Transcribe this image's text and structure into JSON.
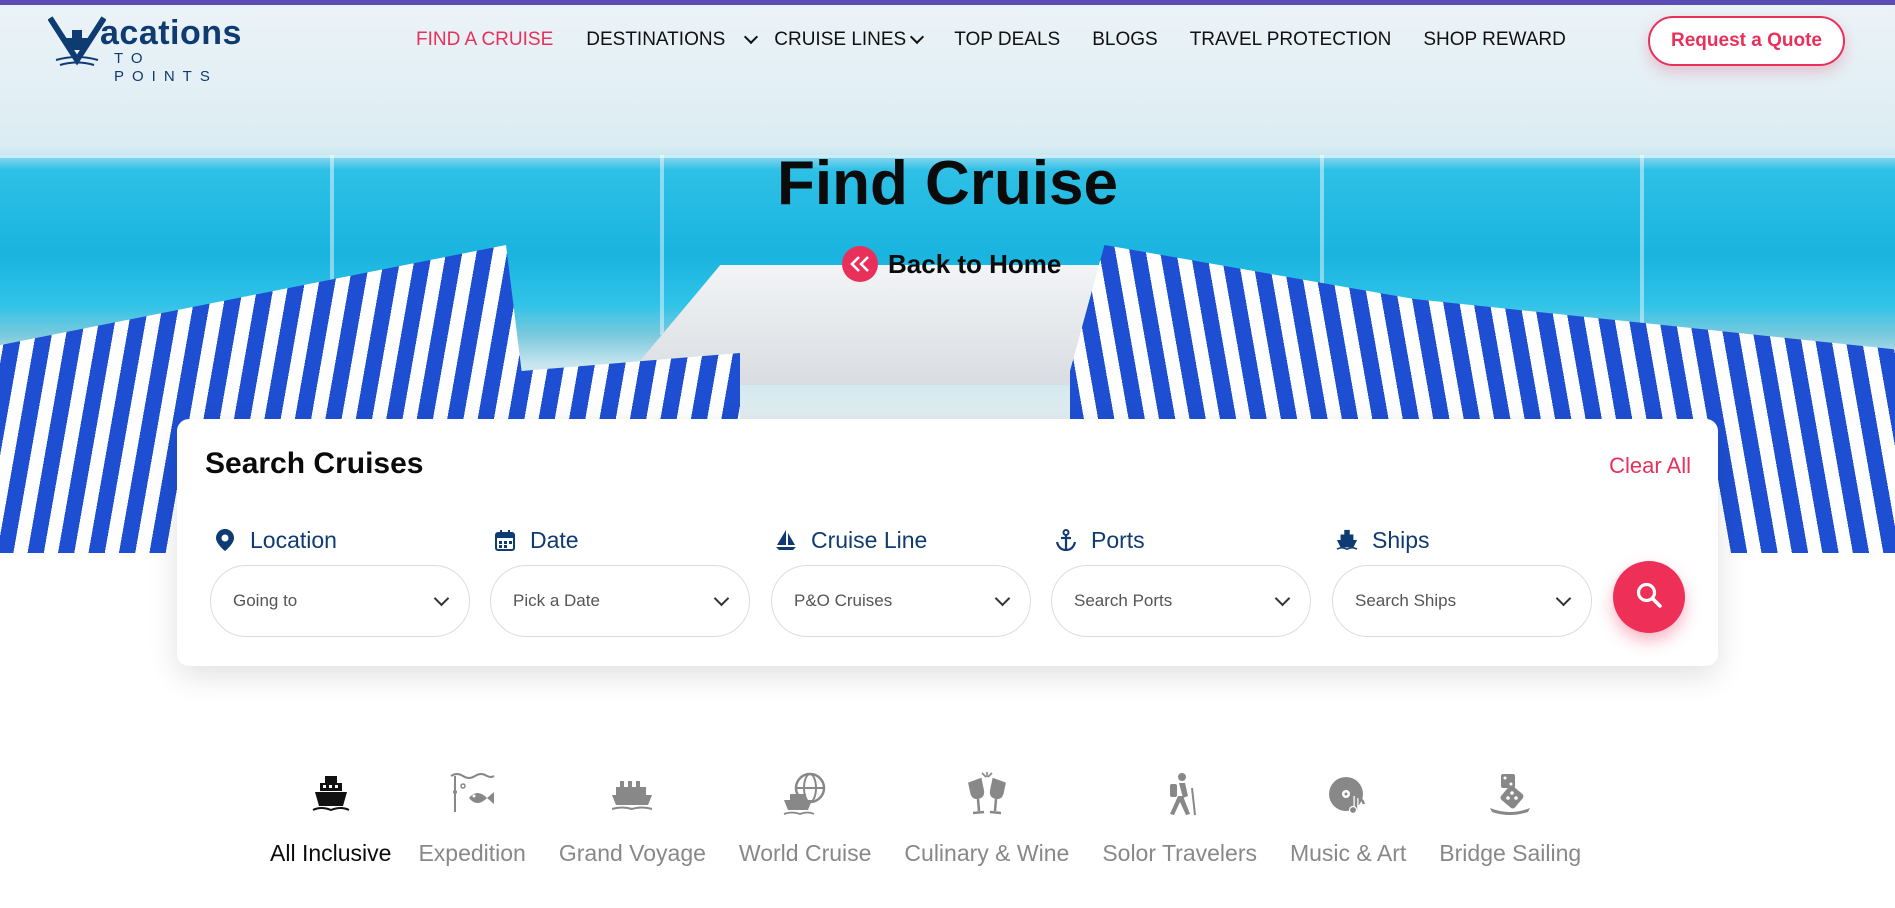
{
  "header": {
    "logo": {
      "main": "acations",
      "sub": "TO POINTS"
    },
    "nav": [
      {
        "label": "FIND A CRUISE",
        "active": true,
        "dropdown": false
      },
      {
        "label": "DESTINATIONS",
        "active": false,
        "dropdown": true
      },
      {
        "label": "CRUISE LINES",
        "active": false,
        "dropdown": true
      },
      {
        "label": "TOP DEALS",
        "active": false,
        "dropdown": false
      },
      {
        "label": "BLOGS",
        "active": false,
        "dropdown": false
      },
      {
        "label": "TRAVEL PROTECTION",
        "active": false,
        "dropdown": false
      },
      {
        "label": "SHOP REWARD",
        "active": false,
        "dropdown": false
      }
    ],
    "quote_button": "Request a Quote"
  },
  "hero": {
    "title": "Find Cruise",
    "back_link": "Back to Home",
    "back_icon": "double-chevron-left-icon"
  },
  "search": {
    "title": "Search Cruises",
    "clear_all": "Clear All",
    "fields": [
      {
        "label": "Location",
        "icon": "location-pin-icon",
        "value": "Going to"
      },
      {
        "label": "Date",
        "icon": "calendar-icon",
        "value": "Pick a Date"
      },
      {
        "label": "Cruise Line",
        "icon": "sailboat-icon",
        "value": "P&O Cruises"
      },
      {
        "label": "Ports",
        "icon": "anchor-icon",
        "value": "Search Ports"
      },
      {
        "label": "Ships",
        "icon": "ship-icon",
        "value": "Search Ships"
      }
    ],
    "search_button_icon": "search-icon"
  },
  "categories": [
    {
      "label": "All Inclusive",
      "icon": "cruise-ship-icon",
      "active": true
    },
    {
      "label": "Expedition",
      "icon": "fish-icon",
      "active": false
    },
    {
      "label": "Grand Voyage",
      "icon": "liner-icon",
      "active": false
    },
    {
      "label": "World Cruise",
      "icon": "globe-ship-icon",
      "active": false
    },
    {
      "label": "Culinary & Wine",
      "icon": "wine-glasses-icon",
      "active": false
    },
    {
      "label": "Solor Travelers",
      "icon": "hiker-icon",
      "active": false
    },
    {
      "label": "Music & Art",
      "icon": "music-disc-icon",
      "active": false
    },
    {
      "label": "Bridge Sailing",
      "icon": "dice-icon",
      "active": false
    }
  ],
  "colors": {
    "accent": "#e8305a",
    "brand": "#0f3b73",
    "topbar": "#5b4bb5"
  }
}
